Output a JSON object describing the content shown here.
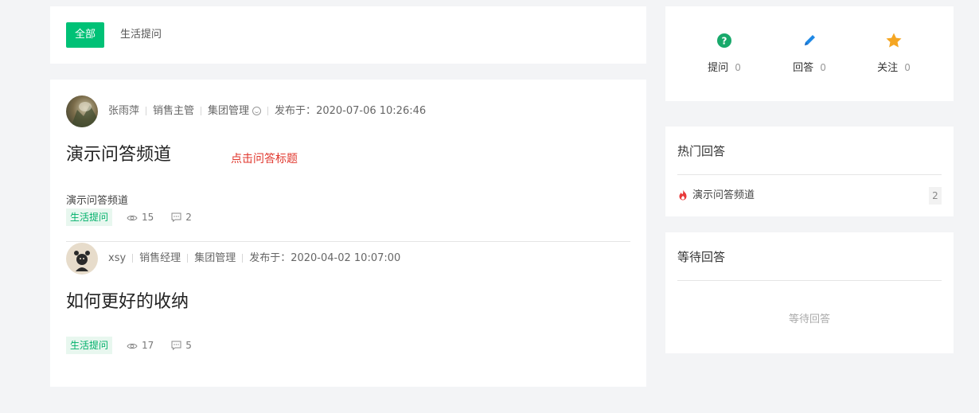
{
  "filter": {
    "all_label": "全部",
    "life_label": "生活提问"
  },
  "annotation": "点击问答标题",
  "questions": [
    {
      "author": "张雨萍",
      "role": "销售主管",
      "group": "集团管理",
      "published_prefix": "发布于：",
      "published": "2020-07-06 10:26:46",
      "title": "演示问答频道",
      "description": "演示问答频道",
      "tag": "生活提问",
      "views": "15",
      "comments": "2"
    },
    {
      "author": "xsy",
      "role": "销售经理",
      "group": "集团管理",
      "published_prefix": "发布于：",
      "published": "2020-04-02 10:07:00",
      "title": "如何更好的收纳",
      "tag": "生活提问",
      "views": "17",
      "comments": "5"
    }
  ],
  "stats": {
    "ask_label": "提问",
    "ask_count": "0",
    "answer_label": "回答",
    "answer_count": "0",
    "follow_label": "关注",
    "follow_count": "0"
  },
  "hot": {
    "title": "热门回答",
    "items": [
      {
        "label": "演示问答频道",
        "count": "2"
      }
    ]
  },
  "waiting": {
    "title": "等待回答",
    "empty": "等待回答"
  },
  "colors": {
    "accent": "#00c176",
    "annotation": "#e0362c",
    "tag_bg": "#e8f7ef"
  },
  "icons": [
    "question-circle-icon",
    "pencil-icon",
    "star-icon",
    "fire-icon",
    "eye-icon",
    "comment-icon",
    "smile-icon"
  ]
}
